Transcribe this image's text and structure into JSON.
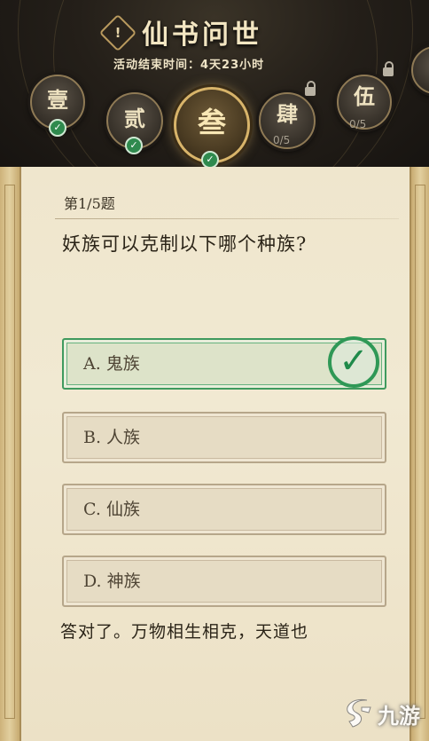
{
  "header": {
    "title": "仙书问世",
    "alert_glyph": "!",
    "end_time": "活动结束时间：4天23小时"
  },
  "chapters": [
    {
      "label": "壹",
      "state": "completed"
    },
    {
      "label": "贰",
      "state": "completed"
    },
    {
      "label": "叁",
      "state": "active-completed"
    },
    {
      "label": "肆",
      "state": "locked",
      "progress": "0/5"
    },
    {
      "label": "伍",
      "state": "locked",
      "progress": "0/5"
    }
  ],
  "quiz": {
    "number": "第1/5题",
    "question": "妖族可以克制以下哪个种族?",
    "options": [
      {
        "label": "A. 鬼族",
        "correct": true
      },
      {
        "label": "B. 人族",
        "correct": false
      },
      {
        "label": "C. 仙族",
        "correct": false
      },
      {
        "label": "D. 神族",
        "correct": false
      }
    ],
    "explanation": "答对了。万物相生相克，天道也"
  },
  "watermark": {
    "text": "九游"
  },
  "colors": {
    "correct_green": "#2f9856",
    "gold_accent": "#d8b46a",
    "parchment": "#efe6cd"
  }
}
